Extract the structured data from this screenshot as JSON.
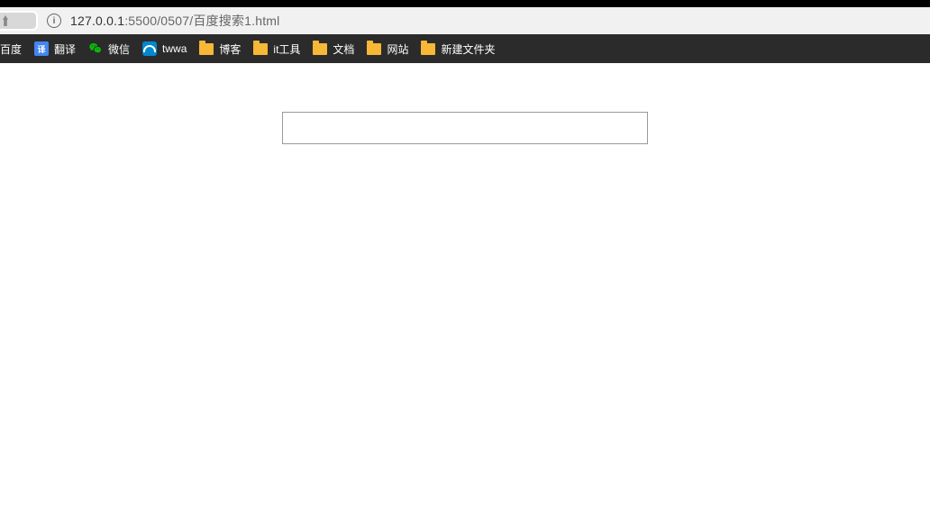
{
  "addressBar": {
    "infoGlyph": "i",
    "url": {
      "host": "127.0.0.1",
      "rest": ":5500/0507/百度搜索1.html"
    }
  },
  "bookmarks": [
    {
      "type": "text-only",
      "label": "百度",
      "name": "bookmark-baidu"
    },
    {
      "type": "translate",
      "label": "翻译",
      "name": "bookmark-translate",
      "iconText": "译"
    },
    {
      "type": "wechat",
      "label": "微信",
      "name": "bookmark-wechat"
    },
    {
      "type": "twwa",
      "label": "twwa",
      "name": "bookmark-twwa"
    },
    {
      "type": "folder",
      "label": "博客",
      "name": "bookmark-blog"
    },
    {
      "type": "folder",
      "label": "it工具",
      "name": "bookmark-ittools"
    },
    {
      "type": "folder",
      "label": "文档",
      "name": "bookmark-docs"
    },
    {
      "type": "folder",
      "label": "网站",
      "name": "bookmark-sites"
    },
    {
      "type": "folder",
      "label": "新建文件夹",
      "name": "bookmark-newfolder"
    }
  ],
  "page": {
    "searchValue": ""
  }
}
